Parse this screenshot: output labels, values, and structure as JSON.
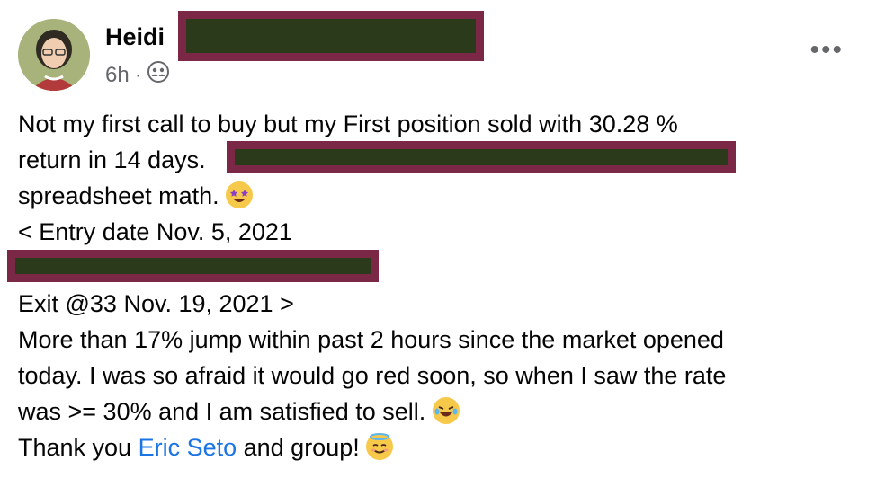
{
  "post": {
    "author": "Heidi",
    "time": "6h",
    "separator": "·",
    "privacy_icon": "friends-icon",
    "more_icon": "more-options-icon",
    "more_label": "•••"
  },
  "body": {
    "line1": "Not my first call to buy but my First position sold with 30.28 %",
    "line2": "return in 14 days.",
    "line3": "spreadsheet math.",
    "line4": "< Entry date  Nov. 5, 2021",
    "line6": "Exit @33  Nov. 19, 2021 >",
    "line7": "More than 17% jump within past 2 hours since the market opened",
    "line8": "today. I was so afraid it would go red soon, so when I saw the rate",
    "line9": "was  >= 30% and I am satisfied to sell.",
    "line10_before": "Thank you ",
    "line10_link": "Eric Seto",
    "line10_after": " and group!"
  }
}
